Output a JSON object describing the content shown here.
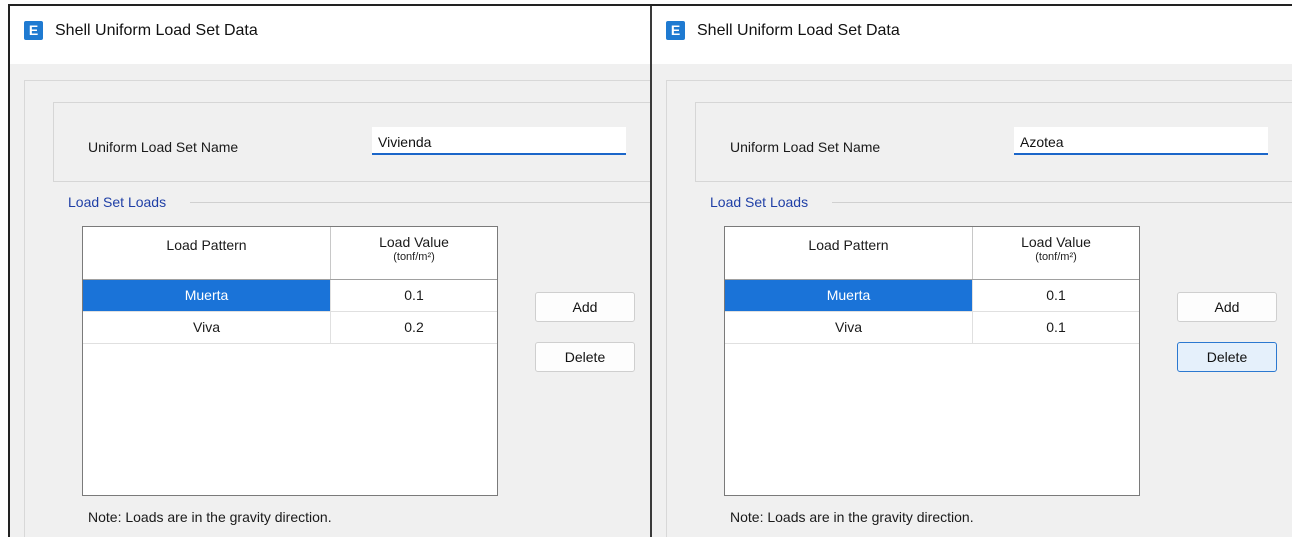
{
  "dialogs": [
    {
      "icon_letter": "E",
      "title": "Shell Uniform Load Set Data",
      "name_label": "Uniform Load Set Name",
      "name_value": "Vivienda",
      "group_label": "Load Set Loads",
      "columns": {
        "pattern": "Load Pattern",
        "value": "Load Value",
        "unit": "(tonf/m²)"
      },
      "rows": [
        {
          "pattern": "Muerta",
          "value": "0.1",
          "selected": true
        },
        {
          "pattern": "Viva",
          "value": "0.2",
          "selected": false
        }
      ],
      "add_label": "Add",
      "delete_label": "Delete",
      "note": "Note:  Loads are in the gravity direction."
    },
    {
      "icon_letter": "E",
      "title": "Shell Uniform Load Set Data",
      "name_label": "Uniform Load Set Name",
      "name_value": "Azotea",
      "group_label": "Load Set Loads",
      "columns": {
        "pattern": "Load Pattern",
        "value": "Load Value",
        "unit": "(tonf/m²)"
      },
      "rows": [
        {
          "pattern": "Muerta",
          "value": "0.1",
          "selected": true
        },
        {
          "pattern": "Viva",
          "value": "0.1",
          "selected": false
        }
      ],
      "add_label": "Add",
      "delete_label": "Delete",
      "note": "Note:  Loads are in the gravity direction."
    }
  ],
  "colors": {
    "accent": "#1a73d8",
    "group_label": "#1f3fa6",
    "icon_bg": "#1f7ad1",
    "dialog_bg": "#f0f0f0"
  },
  "icons": {
    "app": "etabs-app-icon"
  }
}
